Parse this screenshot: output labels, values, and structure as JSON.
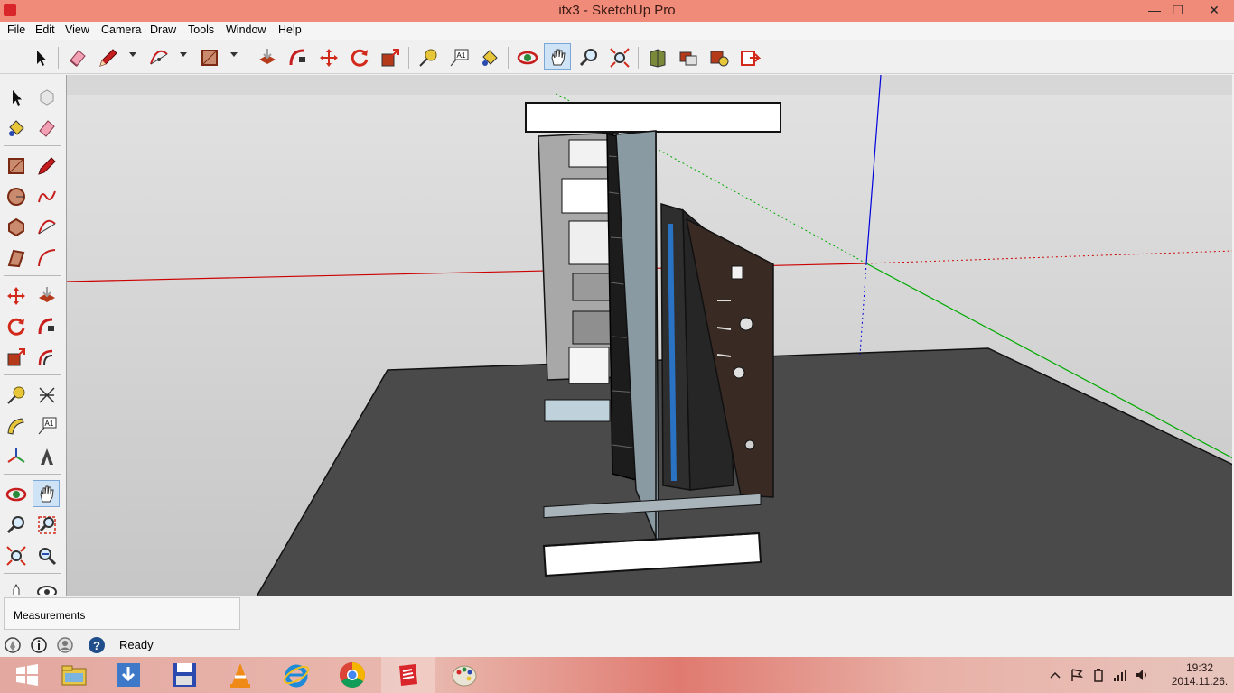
{
  "window": {
    "title": "itx3 - SketchUp Pro",
    "controls": {
      "minimize": "—",
      "restore": "❐",
      "close": "✕"
    }
  },
  "menu": {
    "items": [
      "File",
      "Edit",
      "View",
      "Camera",
      "Draw",
      "Tools",
      "Window",
      "Help"
    ]
  },
  "toolbar": {
    "icons": [
      "select-icon",
      "eraser-icon",
      "pencil-icon",
      "arc-icon",
      "rectangle-icon",
      "push-pull-icon",
      "follow-me-icon",
      "move-icon",
      "rotate-icon",
      "scale-icon",
      "tape-measure-icon",
      "text-icon",
      "paint-bucket-icon",
      "orbit-icon",
      "pan-icon",
      "zoom-icon",
      "zoom-extents-icon",
      "3d-warehouse-icon",
      "components-icon",
      "extension-warehouse-icon",
      "layout-icon"
    ]
  },
  "lefttools": {
    "icons": [
      "select-icon",
      "make-component-icon",
      "paint-bucket-icon",
      "eraser-icon",
      "rectangle-icon",
      "line-icon",
      "circle-icon",
      "freehand-icon",
      "polygon-icon",
      "arc-icon",
      "rotated-rectangle-icon",
      "two-point-arc-icon",
      "move-icon",
      "push-pull-icon",
      "rotate-icon",
      "follow-me-icon",
      "scale-icon",
      "offset-icon",
      "tape-measure-icon",
      "dimension-icon",
      "protractor-icon",
      "text-icon",
      "axes-icon",
      "3d-text-icon",
      "orbit-icon",
      "pan-icon",
      "zoom-icon",
      "zoom-window-icon",
      "zoom-extents-icon",
      "previous-view-icon",
      "position-camera-icon",
      "look-around-icon"
    ]
  },
  "measurements": {
    "label": "Measurements",
    "value": ""
  },
  "status": {
    "text": "Ready"
  },
  "taskbar": {
    "apps": [
      "start-icon",
      "file-explorer-icon",
      "downloads-icon",
      "save-icon",
      "vlc-icon",
      "internet-explorer-icon",
      "chrome-icon",
      "sketchup-icon",
      "paint-icon"
    ],
    "clock_time": "19:32",
    "clock_date": "2014.11.26."
  },
  "colors": {
    "titlebar": "#f08b7a",
    "viewport_sky": "#c9c9c9",
    "ground": "#4a4a4a",
    "axis_red": "#cc0000",
    "axis_green": "#00aa00",
    "axis_blue": "#0000dd",
    "gpu_blue": "#2a72c4",
    "active_tool": "#cfe3f7"
  }
}
